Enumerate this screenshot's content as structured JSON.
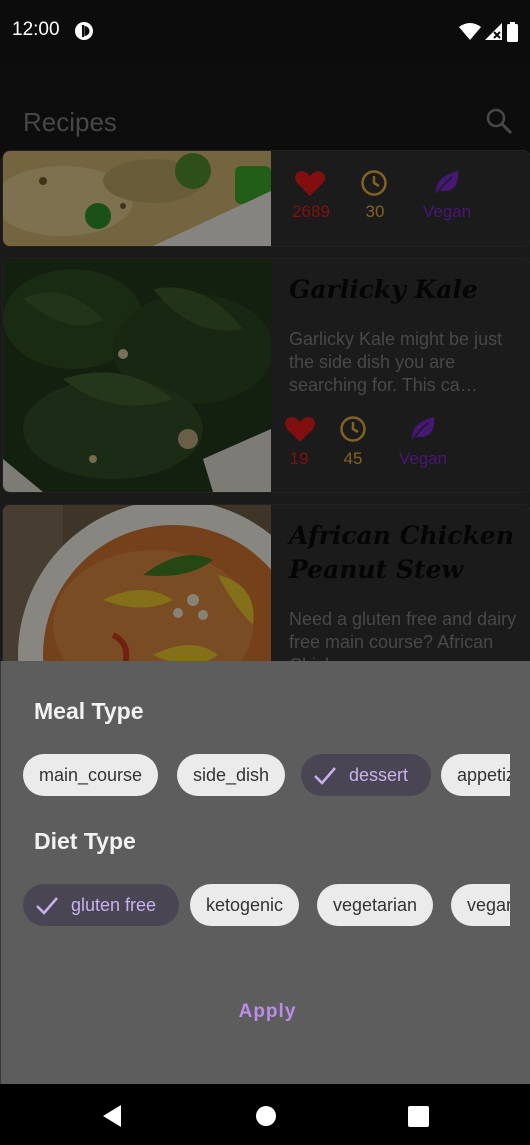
{
  "status_bar": {
    "time": "12:00"
  },
  "app_bar": {
    "title": "Recipes"
  },
  "recipes": [
    {
      "title": "",
      "description": "",
      "likes": "2689",
      "minutes": "30",
      "diet": "Vegan"
    },
    {
      "title": "Garlicky Kale",
      "description": "Garlicky Kale might be just the side dish you are searching for. This ca…",
      "likes": "19",
      "minutes": "45",
      "diet": "Vegan"
    },
    {
      "title": "African Chicken Peanut Stew",
      "description": "Need a gluten free and dairy free main course? African Chicken"
    }
  ],
  "filter_sheet": {
    "meal_type_title": "Meal Type",
    "meal_types": [
      "main_course",
      "side_dish",
      "dessert",
      "appetizer"
    ],
    "selected_meal_type": "dessert",
    "diet_type_title": "Diet Type",
    "diet_types": [
      "gluten free",
      "ketogenic",
      "vegetarian",
      "vegan"
    ],
    "selected_diet_type": "gluten free",
    "apply_label": "Apply"
  },
  "colors": {
    "like": "#e01b1b",
    "time": "#e0a93a",
    "vegan": "#7b28c9",
    "accent": "#b98de8"
  }
}
